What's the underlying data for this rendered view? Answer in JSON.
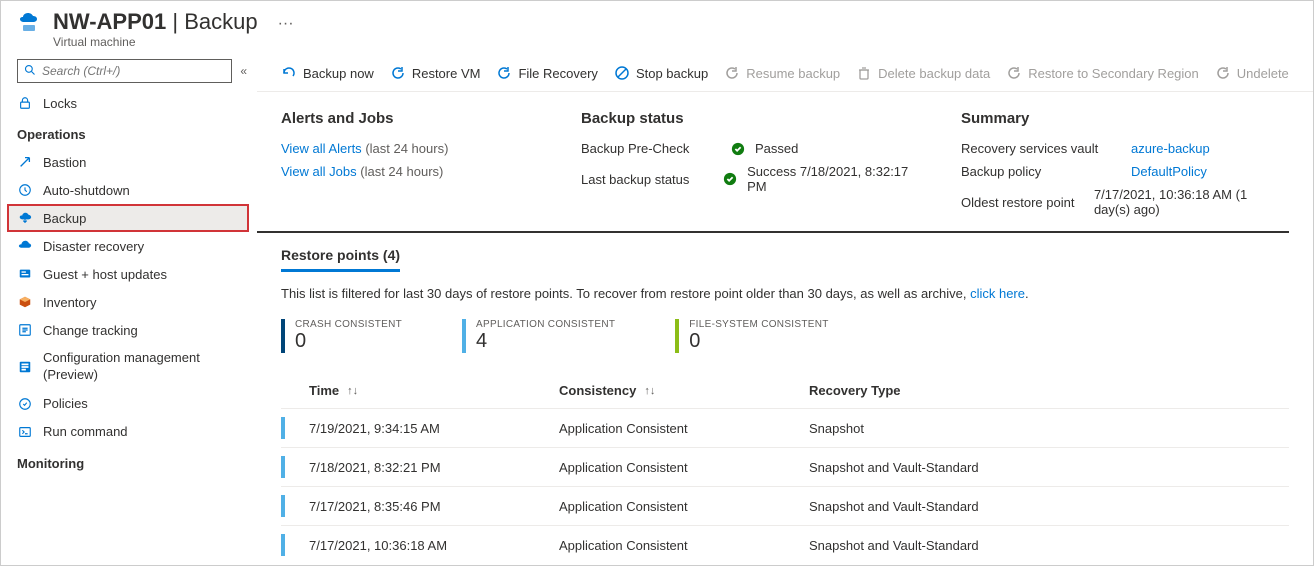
{
  "header": {
    "title_prefix": "NW-APP01",
    "title_sep": " | ",
    "title_suffix": "Backup",
    "subtitle": "Virtual machine",
    "more": "···"
  },
  "search": {
    "placeholder": "Search (Ctrl+/)"
  },
  "sidebar": {
    "top_item": {
      "label": "Locks"
    },
    "group1": "Operations",
    "items": [
      {
        "label": "Bastion"
      },
      {
        "label": "Auto-shutdown"
      },
      {
        "label": "Backup"
      },
      {
        "label": "Disaster recovery"
      },
      {
        "label": "Guest + host updates"
      },
      {
        "label": "Inventory"
      },
      {
        "label": "Change tracking"
      },
      {
        "label": "Configuration management (Preview)"
      },
      {
        "label": "Policies"
      },
      {
        "label": "Run command"
      }
    ],
    "group2": "Monitoring"
  },
  "toolbar": {
    "backup_now": "Backup now",
    "restore_vm": "Restore VM",
    "file_recovery": "File Recovery",
    "stop_backup": "Stop backup",
    "resume_backup": "Resume backup",
    "delete_backup": "Delete backup data",
    "restore_secondary": "Restore to Secondary Region",
    "undelete": "Undelete"
  },
  "alerts": {
    "title": "Alerts and Jobs",
    "view_alerts": "View all Alerts",
    "view_alerts_suffix": "(last 24 hours)",
    "view_jobs": "View all Jobs",
    "view_jobs_suffix": "(last 24 hours)"
  },
  "status": {
    "title": "Backup status",
    "precheck_label": "Backup Pre-Check",
    "precheck_value": "Passed",
    "last_label": "Last backup status",
    "last_value": "Success 7/18/2021, 8:32:17 PM"
  },
  "summary": {
    "title": "Summary",
    "vault_label": "Recovery services vault",
    "vault_value": "azure-backup",
    "policy_label": "Backup policy",
    "policy_value": "DefaultPolicy",
    "oldest_label": "Oldest restore point",
    "oldest_value": "7/17/2021, 10:36:18 AM (1 day(s) ago)"
  },
  "restore": {
    "tab": "Restore points (4)",
    "note_prefix": "This list is filtered for last 30 days of restore points. To recover from restore point older than 30 days, as well as archive, ",
    "note_link": "click here",
    "note_suffix": ".",
    "counters": [
      {
        "label": "CRASH CONSISTENT",
        "value": "0",
        "color": "#004578"
      },
      {
        "label": "APPLICATION CONSISTENT",
        "value": "4",
        "color": "#50b0e6"
      },
      {
        "label": "FILE-SYSTEM CONSISTENT",
        "value": "0",
        "color": "#8cbd18"
      }
    ],
    "headers": {
      "time": "Time",
      "consistency": "Consistency",
      "recovery": "Recovery Type"
    },
    "rows": [
      {
        "time": "7/19/2021, 9:34:15 AM",
        "consistency": "Application Consistent",
        "recovery": "Snapshot"
      },
      {
        "time": "7/18/2021, 8:32:21 PM",
        "consistency": "Application Consistent",
        "recovery": "Snapshot and Vault-Standard"
      },
      {
        "time": "7/17/2021, 8:35:46 PM",
        "consistency": "Application Consistent",
        "recovery": "Snapshot and Vault-Standard"
      },
      {
        "time": "7/17/2021, 10:36:18 AM",
        "consistency": "Application Consistent",
        "recovery": "Snapshot and Vault-Standard"
      }
    ]
  }
}
